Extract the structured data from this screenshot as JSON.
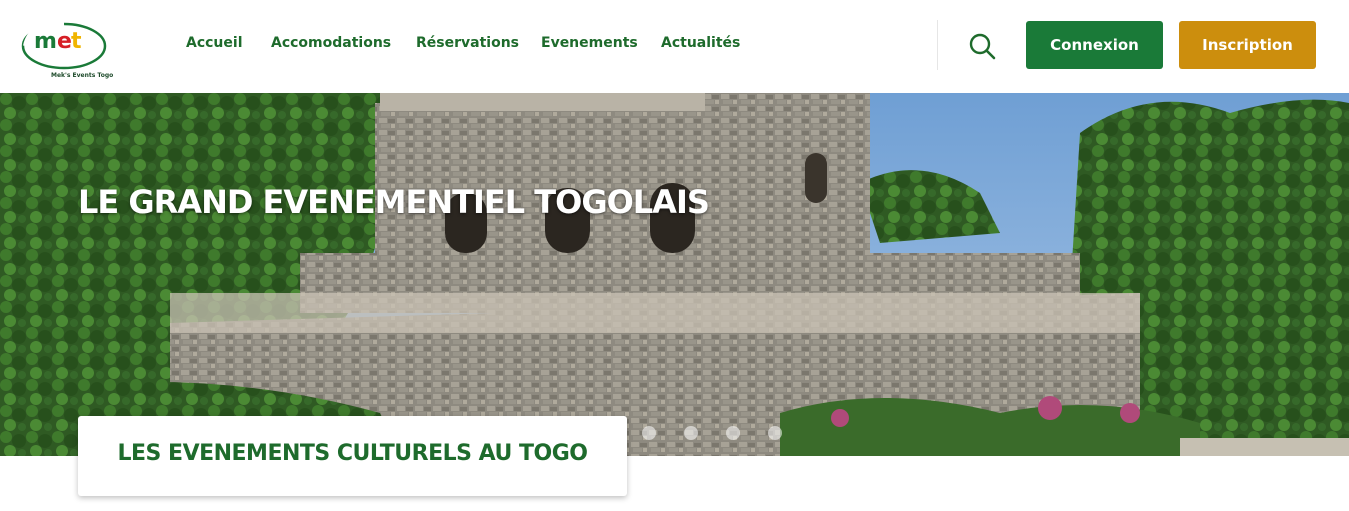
{
  "brand": {
    "logo_letters": "met",
    "logo_caption": "Mek's Events Togo"
  },
  "nav": {
    "items": [
      {
        "label": "Accueil",
        "active": true
      },
      {
        "label": "Accomodations",
        "active": false
      },
      {
        "label": "Réservations",
        "active": false
      },
      {
        "label": "Evenements",
        "active": false
      },
      {
        "label": "Actualités",
        "active": false
      }
    ]
  },
  "header": {
    "search_icon": "search-icon",
    "login_label": "Connexion",
    "signup_label": "Inscription"
  },
  "hero": {
    "title": "LE GRAND EVENEMENTIEL TOGOLAIS",
    "slide_count": 4
  },
  "card": {
    "title": "LES EVENEMENTS CULTURELS AU TOGO"
  },
  "colors": {
    "brand_green": "#1a7a38",
    "brand_gold": "#cc8e0d",
    "nav_green": "#1e6b2c",
    "active_underline": "#f3c315"
  }
}
